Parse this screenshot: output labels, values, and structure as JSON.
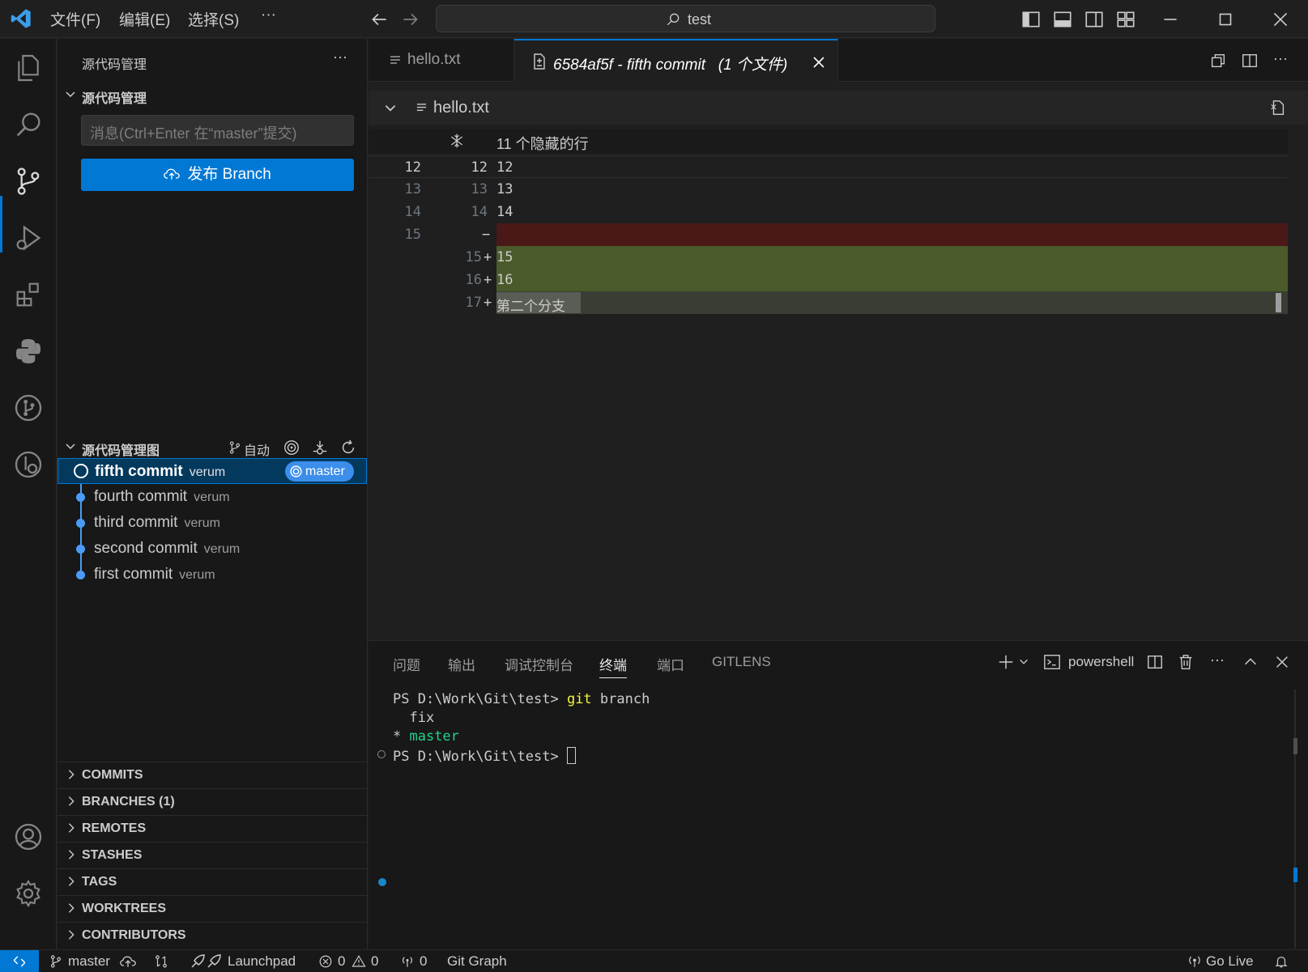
{
  "titlebar": {
    "menus": [
      "文件(F)",
      "编辑(E)",
      "选择(S)",
      "···"
    ],
    "search": "test"
  },
  "sidebar": {
    "title": "源代码管理",
    "scm_section": "源代码管理",
    "commit_placeholder": "消息(Ctrl+Enter 在“master”提交)",
    "publish_label": "发布 Branch",
    "graph_section": "源代码管理图",
    "graph_auto": "自动",
    "graph_commits": [
      {
        "message": "fifth commit",
        "author": "verum",
        "badge": "master"
      },
      {
        "message": "fourth commit",
        "author": "verum"
      },
      {
        "message": "third commit",
        "author": "verum"
      },
      {
        "message": "second commit",
        "author": "verum"
      },
      {
        "message": "first commit",
        "author": "verum"
      }
    ],
    "gitlens_sections": [
      "COMMITS",
      "BRANCHES (1)",
      "REMOTES",
      "STASHES",
      "TAGS",
      "WORKTREES",
      "CONTRIBUTORS"
    ]
  },
  "editor": {
    "tabs": [
      {
        "label": "hello.txt"
      },
      {
        "label": "6584af5f - fifth commit   (1 个文件)"
      }
    ],
    "file_header": "hello.txt",
    "hidden_lines": "11 个隐藏的行",
    "diff_lines": [
      {
        "left": "12",
        "right": "12",
        "sign": "",
        "text": "12"
      },
      {
        "left": "13",
        "right": "13",
        "sign": "",
        "text": "13"
      },
      {
        "left": "14",
        "right": "14",
        "sign": "",
        "text": "14"
      },
      {
        "left": "15",
        "right": "",
        "sign": "−",
        "text": ""
      },
      {
        "left": "",
        "right": "15",
        "sign": "+",
        "text": "15"
      },
      {
        "left": "",
        "right": "16",
        "sign": "+",
        "text": "16"
      },
      {
        "left": "",
        "right": "17",
        "sign": "+",
        "text": "第二个分支"
      }
    ]
  },
  "panel": {
    "tabs": [
      "问题",
      "输出",
      "调试控制台",
      "终端",
      "端口",
      "GITLENS"
    ],
    "active_tab": "终端",
    "shell": "powershell",
    "terminal": {
      "prompt": "PS D:\\Work\\Git\\test>",
      "command_git": "git",
      "command_rest": " branch",
      "branch_fix": "  fix",
      "star": "* ",
      "branch_master": "master"
    }
  },
  "statusbar": {
    "branch": "master",
    "launchpad": "Launchpad",
    "errors": "0",
    "warnings": "0",
    "ports": "0",
    "git_graph": "Git Graph",
    "go_live": "Go Live"
  },
  "colors": {
    "accent": "#0078d4",
    "removed_line": "#4b1818",
    "added_line": "#4b5a2a",
    "added_text_hl": "#3a3d33",
    "git_command": "#f5f543",
    "master_green": "#23d18b"
  }
}
